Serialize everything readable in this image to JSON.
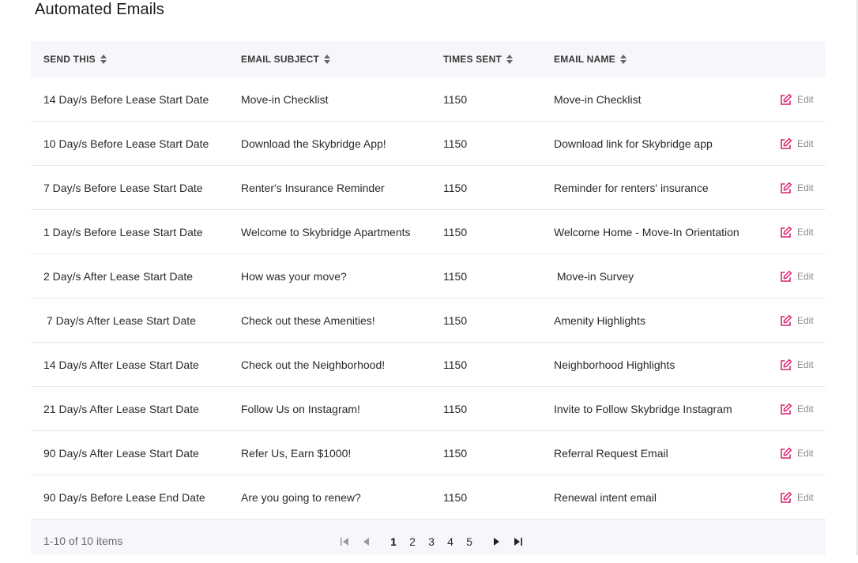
{
  "page": {
    "title": "Automated Emails"
  },
  "table": {
    "headers": {
      "send_this": "SEND THIS",
      "email_subject": "EMAIL SUBJECT",
      "times_sent": "TIMES SENT",
      "email_name": "EMAIL NAME"
    },
    "edit_label": "Edit",
    "rows": [
      {
        "send_this": "14 Day/s Before Lease Start Date",
        "subject": "Move-in Checklist",
        "times_sent": "1150",
        "name": "Move-in Checklist"
      },
      {
        "send_this": "10 Day/s Before Lease Start Date",
        "subject": "Download the Skybridge App!",
        "times_sent": "1150",
        "name": "Download link for Skybridge app"
      },
      {
        "send_this": "7 Day/s Before Lease Start Date",
        "subject": "Renter's Insurance Reminder",
        "times_sent": "1150",
        "name": "Reminder for renters' insurance"
      },
      {
        "send_this": "1 Day/s Before Lease Start Date",
        "subject": "Welcome to Skybridge Apartments",
        "times_sent": "1150",
        "name": "Welcome Home - Move-In Orientation"
      },
      {
        "send_this": "2 Day/s After Lease Start Date",
        "subject": "How was your move?",
        "times_sent": "1150",
        "name": " Move-in Survey"
      },
      {
        "send_this": " 7 Day/s After Lease Start Date",
        "subject": "Check out these Amenities!",
        "times_sent": "1150",
        "name": "Amenity Highlights"
      },
      {
        "send_this": "14 Day/s After Lease Start Date",
        "subject": "Check out the Neighborhood!",
        "times_sent": "1150",
        "name": "Neighborhood Highlights"
      },
      {
        "send_this": "21 Day/s After Lease Start Date",
        "subject": "Follow Us on Instagram!",
        "times_sent": "1150",
        "name": "Invite to Follow Skybridge Instagram"
      },
      {
        "send_this": "90 Day/s After Lease Start Date",
        "subject": "Refer Us, Earn $1000!",
        "times_sent": "1150",
        "name": "Referral Request Email"
      },
      {
        "send_this": "90 Day/s Before Lease End Date",
        "subject": "Are you going to renew?",
        "times_sent": "1150",
        "name": "Renewal intent email"
      }
    ]
  },
  "pagination": {
    "info": "1-10 of 10 items",
    "pages": [
      "1",
      "2",
      "3",
      "4",
      "5"
    ],
    "current": "1"
  },
  "colors": {
    "accent": "#d6246e",
    "header_bg": "#f5f7fa"
  },
  "icons": {
    "edit": "edit-icon",
    "first": "first-page-icon",
    "prev": "previous-page-icon",
    "next": "next-page-icon",
    "last": "last-page-icon",
    "sort": "sort-icon"
  }
}
